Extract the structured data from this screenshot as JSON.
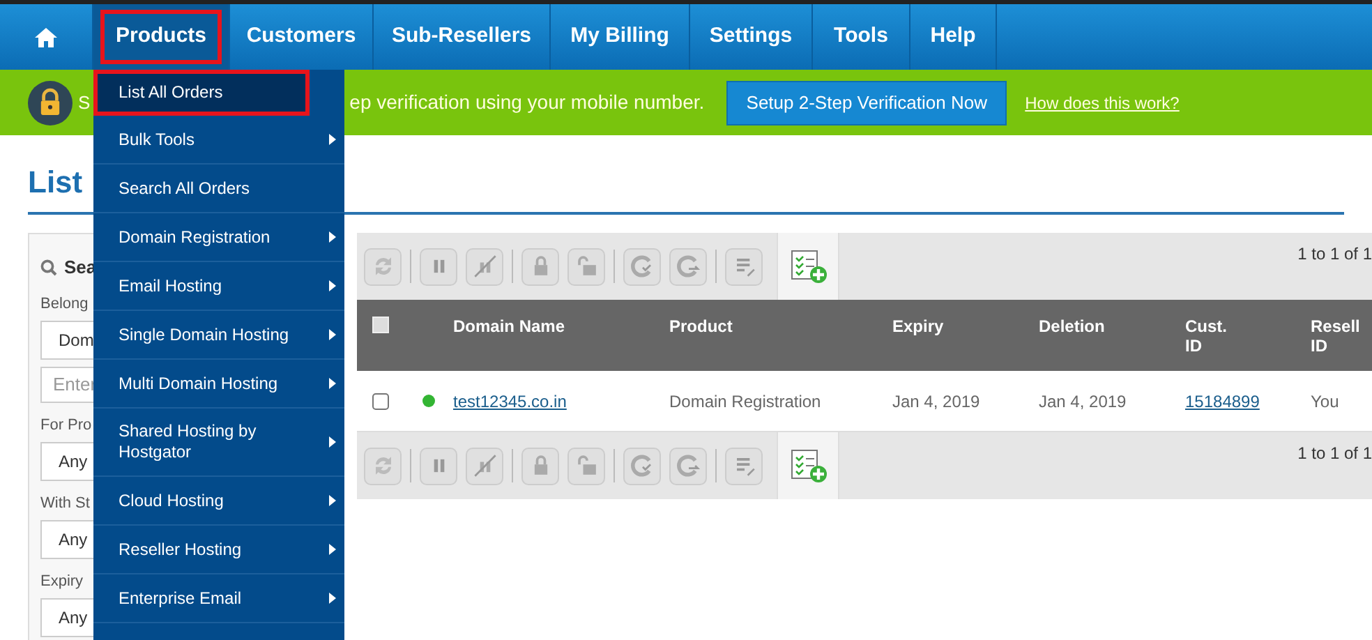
{
  "nav": {
    "items": [
      {
        "label": "Products",
        "selected": true,
        "highlighted": true
      },
      {
        "label": "Customers",
        "selected": false,
        "highlighted": false
      },
      {
        "label": "Sub-Resellers",
        "selected": false,
        "highlighted": false
      },
      {
        "label": "My Billing",
        "selected": false,
        "highlighted": false
      },
      {
        "label": "Settings",
        "selected": false,
        "highlighted": false
      },
      {
        "label": "Tools",
        "selected": false,
        "highlighted": false
      },
      {
        "label": "Help",
        "selected": false,
        "highlighted": false
      }
    ]
  },
  "banner": {
    "text_start": "S",
    "text_end": "ep verification using your mobile number.",
    "button": "Setup 2-Step Verification Now",
    "link": "How does this work?"
  },
  "page_title": "List",
  "search_panel": {
    "title": "Sea",
    "fields": [
      {
        "kind": "label",
        "text": "Belong"
      },
      {
        "kind": "select",
        "value": "Dom"
      },
      {
        "kind": "input",
        "placeholder": "Enter"
      },
      {
        "kind": "label",
        "text": "For Pro"
      },
      {
        "kind": "select",
        "value": "Any"
      },
      {
        "kind": "label",
        "text": "With St"
      },
      {
        "kind": "select",
        "value": "Any"
      },
      {
        "kind": "label",
        "text": "Expiry"
      },
      {
        "kind": "select",
        "value": "Any"
      }
    ]
  },
  "orders": {
    "pager_top": "1 to 1 of 1",
    "pager_bottom": "1 to 1 of 1",
    "header_checked": false,
    "columns": [
      "Domain Name",
      "Product",
      "Expiry",
      "Deletion",
      "Cust. ID",
      "Resell ID"
    ],
    "rows": [
      {
        "checked": false,
        "color": "#33b533",
        "cells": [
          {
            "kind": "link",
            "text": "test12345.co.in"
          },
          {
            "kind": "text",
            "text": "Domain Registration"
          },
          {
            "kind": "text",
            "text": "Jan 4, 2019"
          },
          {
            "kind": "text",
            "text": "Jan 4, 2019"
          },
          {
            "kind": "link",
            "text": "15184899"
          },
          {
            "kind": "text",
            "text": "You"
          }
        ]
      }
    ]
  },
  "menu": {
    "items": [
      {
        "label": "List All Orders",
        "submenu": false,
        "selected": true,
        "highlighted": true
      },
      {
        "label": "Bulk Tools",
        "submenu": true,
        "selected": false,
        "highlighted": false
      },
      {
        "label": "Search All Orders",
        "submenu": false,
        "selected": false,
        "highlighted": false
      },
      {
        "label": "Domain Registration",
        "submenu": true,
        "selected": false,
        "highlighted": false
      },
      {
        "label": "Email Hosting",
        "submenu": true,
        "selected": false,
        "highlighted": false
      },
      {
        "label": "Single Domain Hosting",
        "submenu": true,
        "selected": false,
        "highlighted": false
      },
      {
        "label": "Multi Domain Hosting",
        "submenu": true,
        "selected": false,
        "highlighted": false
      },
      {
        "label": "Shared Hosting by Hostgator",
        "submenu": true,
        "selected": false,
        "highlighted": false
      },
      {
        "label": "Cloud Hosting",
        "submenu": true,
        "selected": false,
        "highlighted": false
      },
      {
        "label": "Reseller Hosting",
        "submenu": true,
        "selected": false,
        "highlighted": false
      },
      {
        "label": "Enterprise Email",
        "submenu": true,
        "selected": false,
        "highlighted": false
      }
    ]
  }
}
